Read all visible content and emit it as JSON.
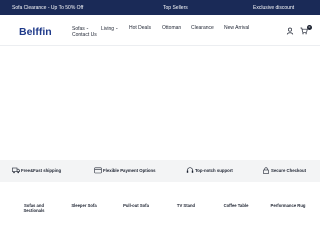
{
  "topbar": {
    "left": "Sofa Clearance - Up To 50% Off",
    "center": "Top Sellers",
    "right": "Exclusive discount",
    "bg_color": "#1a2a57"
  },
  "header": {
    "logo_text": "Belffin",
    "nav": [
      {
        "label": "Sofas",
        "icon": "chevron-down-icon"
      },
      {
        "label": "Living",
        "icon": "chevron-down-icon"
      },
      {
        "label": "Hot Deals"
      },
      {
        "label": "Ottoman"
      },
      {
        "label": "Clearance"
      },
      {
        "label": "New Arrival"
      },
      {
        "label": "Contact Us"
      }
    ],
    "icons": [
      "user-icon",
      "cart-icon"
    ],
    "cart_count": "0"
  },
  "features": [
    {
      "label": "Free&Fast shipping",
      "icon": "truck-icon"
    },
    {
      "label": "Flexible Payment Options",
      "icon": "payment-icon"
    },
    {
      "label": "Top-notch support",
      "icon": "headset-icon"
    },
    {
      "label": "Secure Checkout",
      "icon": "lock-icon"
    }
  ],
  "categories": [
    "Sofas and Sectionals",
    "Sleeper Sofa",
    "Pull-out Sofa",
    "TV Stand",
    "Coffee Table",
    "Performance Rug"
  ]
}
